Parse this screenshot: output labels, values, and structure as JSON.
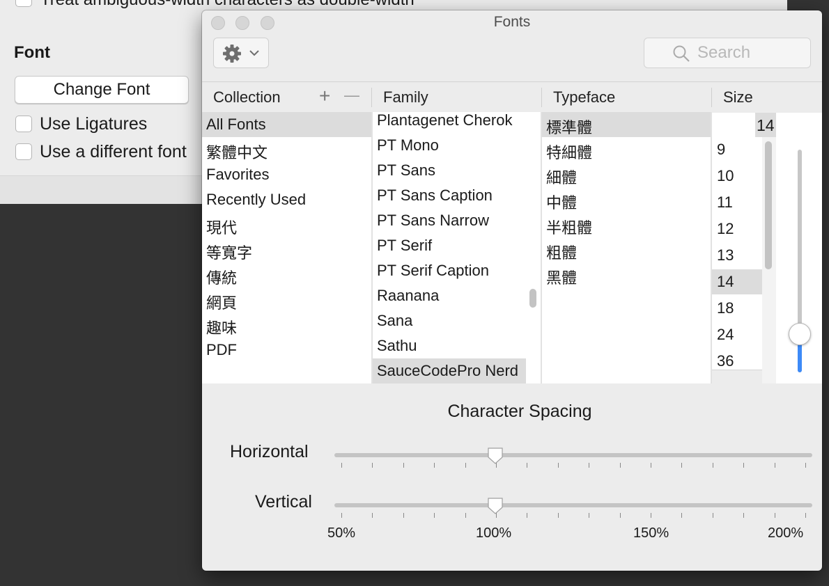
{
  "background_window": {
    "top_checkbox_label": "Treat ambiguous-width characters as double-width",
    "font_heading": "Font",
    "change_font_button": "Change Font",
    "use_ligatures_label": "Use Ligatures",
    "different_font_label": "Use a different font"
  },
  "fonts_panel": {
    "title": "Fonts",
    "search_placeholder": "Search",
    "headers": {
      "collection": "Collection",
      "family": "Family",
      "typeface": "Typeface",
      "size": "Size",
      "add": "+",
      "remove": "—"
    },
    "collections": [
      "All Fonts",
      "繁體中文",
      "Favorites",
      "Recently Used",
      "現代",
      "等寬字",
      "傳統",
      "網頁",
      "趣味",
      "PDF"
    ],
    "collections_selected": "All Fonts",
    "families": [
      "Plantagenet Cherok",
      "PT Mono",
      "PT Sans",
      "PT Sans Caption",
      "PT Sans Narrow",
      "PT Serif",
      "PT Serif Caption",
      "Raanana",
      "Sana",
      "Sathu",
      "SauceCodePro Nerd"
    ],
    "families_selected": "SauceCodePro Nerd",
    "typefaces": [
      "標準體",
      "特細體",
      "細體",
      "中體",
      "半粗體",
      "粗體",
      "黑體"
    ],
    "typefaces_selected": "標準體",
    "size_value": "14",
    "sizes": [
      "9",
      "10",
      "11",
      "12",
      "13",
      "14",
      "18",
      "24",
      "36"
    ],
    "sizes_selected": "14",
    "character_spacing": {
      "title": "Character Spacing",
      "horizontal_label": "Horizontal",
      "vertical_label": "Vertical",
      "horizontal_value": "100%",
      "vertical_value": "100%",
      "scale_labels": [
        "50%",
        "100%",
        "150%",
        "200%"
      ]
    }
  },
  "colors": {
    "accent": "#3d8af7",
    "selection": "#dcdcdc",
    "desktop": "#333333"
  },
  "icons": [
    "gear-icon",
    "chevron-down-icon",
    "search-icon"
  ]
}
